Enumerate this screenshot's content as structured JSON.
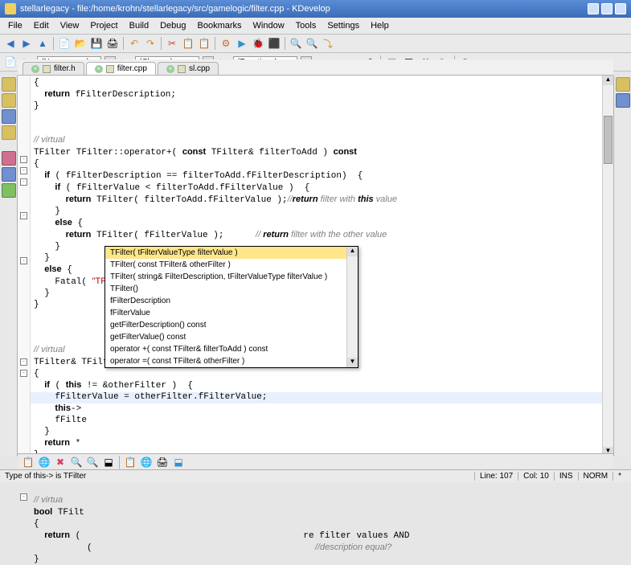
{
  "window": {
    "title": "stellarlegacy - file:/home/krohn/stellarlegacy/src/gamelogic/filter.cpp - KDevelop"
  },
  "menu": {
    "items": [
      "File",
      "Edit",
      "View",
      "Project",
      "Build",
      "Debug",
      "Bookmarks",
      "Window",
      "Tools",
      "Settings",
      "Help"
    ]
  },
  "nav": {
    "namespace_label": "(Namespace)",
    "classes_label": "(Classes)",
    "functions_label": "(Functions)"
  },
  "tabs": {
    "items": [
      {
        "label": "filter.h",
        "active": false
      },
      {
        "label": "filter.cpp",
        "active": true
      },
      {
        "label": "sl.cpp",
        "active": false
      }
    ]
  },
  "code": {
    "lines": [
      {
        "t": "{",
        "indent": 0
      },
      {
        "t": "  return fFilterDescription;",
        "kw": [
          "return"
        ]
      },
      {
        "t": "}",
        "indent": 0
      },
      {
        "t": ""
      },
      {
        "t": ""
      },
      {
        "t": "// virtual",
        "cls": "cmt"
      },
      {
        "t": "TFilter TFilter::operator+( const TFilter& filterToAdd ) const"
      },
      {
        "t": "{"
      },
      {
        "t": "  if ( fFilterDescription == filterToAdd.fFilterDescription)  {"
      },
      {
        "t": "    if ( fFilterValue < filterToAdd.fFilterValue )  {"
      },
      {
        "t": "      return TFilter( filterToAdd.fFilterValue );//return filter with this value"
      },
      {
        "t": "    }"
      },
      {
        "t": "    else {"
      },
      {
        "t": "      return TFilter( fFilterValue );      // return filter with the other value"
      },
      {
        "t": "    }"
      },
      {
        "t": "  }"
      },
      {
        "t": "  else {"
      },
      {
        "t": "    Fatal( \"TFilter\", \"operator+\", \"The filter descriptions didn't match!\" );"
      },
      {
        "t": "  }"
      },
      {
        "t": "}"
      },
      {
        "t": ""
      },
      {
        "t": ""
      },
      {
        "t": ""
      },
      {
        "t": "// virtual",
        "cls": "cmt"
      },
      {
        "t": "TFilter& TFilter::operator=( const TFilter& otherFilter )"
      },
      {
        "t": "{"
      },
      {
        "t": "  if ( this != &otherFilter )  {"
      },
      {
        "t": "    fFilterValue = otherFilter.fFilterValue;"
      },
      {
        "t": "    this->",
        "highlight": true
      },
      {
        "t": "    fFilte"
      },
      {
        "t": "  }"
      },
      {
        "t": "  return *"
      },
      {
        "t": "}"
      },
      {
        "t": ""
      },
      {
        "t": ""
      },
      {
        "t": ""
      },
      {
        "t": "// virtua",
        "cls": "cmt"
      },
      {
        "t": "bool TFilt"
      },
      {
        "t": "{"
      },
      {
        "t": "  return (                                          re filter values AND"
      },
      {
        "t": "          (                                          //description equal?"
      },
      {
        "t": "}"
      }
    ]
  },
  "autocomplete": {
    "items": [
      "TFilter( tFilterValueType filterValue )",
      "TFilter( const TFilter& otherFilter )",
      "TFilter( string& FilterDescription, tFilterValueType filterValue )",
      "TFilter()",
      "fFilterDescription",
      "fFilterValue",
      "getFilterDescription()  const",
      "getFilterValue()  const",
      "operator +( const TFilter& filterToAdd ) const",
      "operator =( const TFilter& otherFilter )"
    ],
    "selected_index": 0
  },
  "status": {
    "message": "Type of this-> is TFilter",
    "line": "Line: 107",
    "col": "Col: 10",
    "ins": "INS",
    "mode": "NORM"
  }
}
